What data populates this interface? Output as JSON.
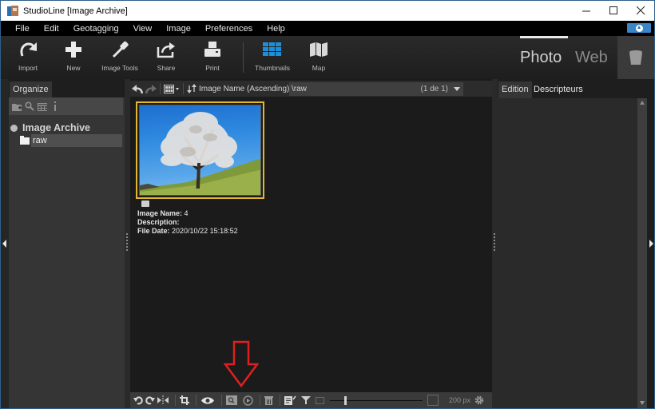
{
  "window": {
    "title": "StudioLine [Image Archive]",
    "controls": [
      "minimize",
      "maximize",
      "close"
    ]
  },
  "menu": [
    "File",
    "Edit",
    "Geotagging",
    "View",
    "Image",
    "Preferences",
    "Help"
  ],
  "toolbar": {
    "import": "Import",
    "new": "New",
    "image_tools": "Image Tools",
    "share": "Share",
    "print": "Print",
    "thumbnails": "Thumbnails",
    "map": "Map",
    "modes": {
      "photo": "Photo",
      "web": "Web",
      "active": "Photo"
    },
    "accent_color": "#1c8fd8"
  },
  "left_panel": {
    "tab": "Organize",
    "tools": [
      "new-folder-icon",
      "search-icon",
      "table-icon",
      "info-icon"
    ],
    "tree": {
      "root": "Image Archive",
      "items": [
        {
          "label": "raw",
          "selected": true
        }
      ]
    }
  },
  "center": {
    "sort_label": "Image Name (Ascending)",
    "path": "\\raw",
    "page_count": "(1 de 1)",
    "thumbnail": {
      "selected": true,
      "selection_color": "#e2b62e",
      "meta": [
        {
          "label": "Image Name:",
          "value": "4"
        },
        {
          "label": "Description:",
          "value": ""
        },
        {
          "label": "File Date:",
          "value": "2020/10/22 15:18:52"
        }
      ]
    },
    "bottom_toolbar": {
      "zoom_value": "200 px",
      "slider_fraction": 0.16
    },
    "annotation_color": "#e02020"
  },
  "right_panel": {
    "tabs": [
      "Edition",
      "Descripteurs"
    ],
    "active_tab": "Edition"
  }
}
